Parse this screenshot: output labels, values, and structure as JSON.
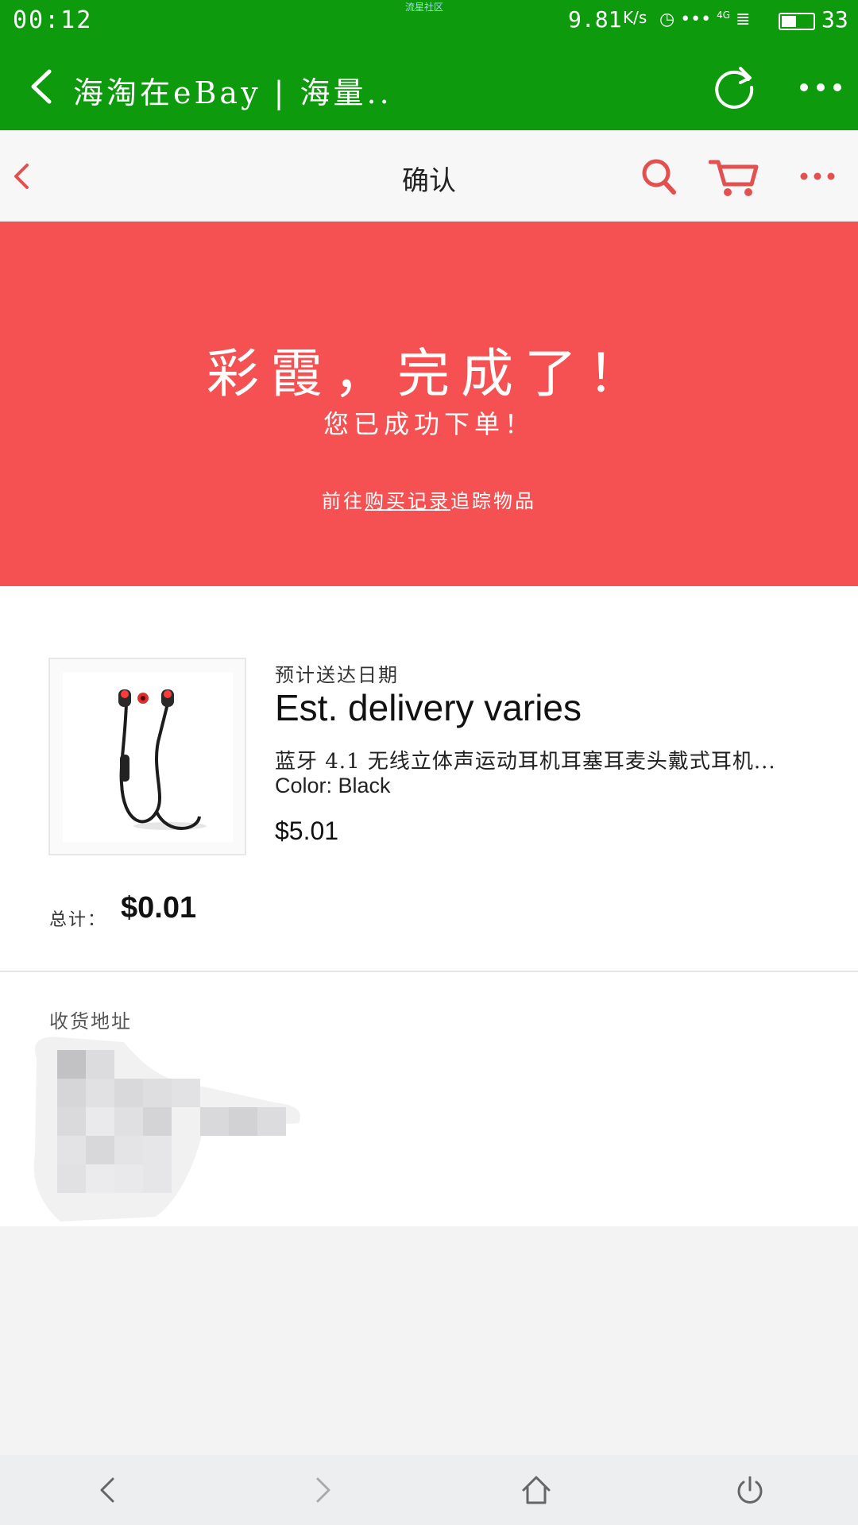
{
  "status_bar": {
    "time": "00:12",
    "carrier_text": "流星社区",
    "net_speed": "9.81",
    "net_speed_unit": "K/s",
    "network": "4G",
    "battery_percent": "33"
  },
  "app_toolbar": {
    "title": "海淘在eBay | 海量.."
  },
  "header": {
    "title": "确认"
  },
  "banner": {
    "headline": "彩霞，完成了！",
    "subtitle": "您已成功下单！",
    "track_prefix": "前往",
    "track_link": "购买记录",
    "track_suffix": "追踪物品"
  },
  "order": {
    "delivery_label": "预计送达日期",
    "delivery_value": "Est. delivery varies",
    "item_title": "蓝牙 4.1 无线立体声运动耳机耳塞耳麦头戴式耳机...",
    "item_color": "Color: Black",
    "item_price": "$5.01",
    "total_label": "总计：",
    "total_value": "$0.01"
  },
  "address": {
    "label": "收货地址"
  },
  "colors": {
    "browser_green": "#0d9a0d",
    "ebay_red": "#f55152",
    "accent_icon": "#e2504f"
  }
}
